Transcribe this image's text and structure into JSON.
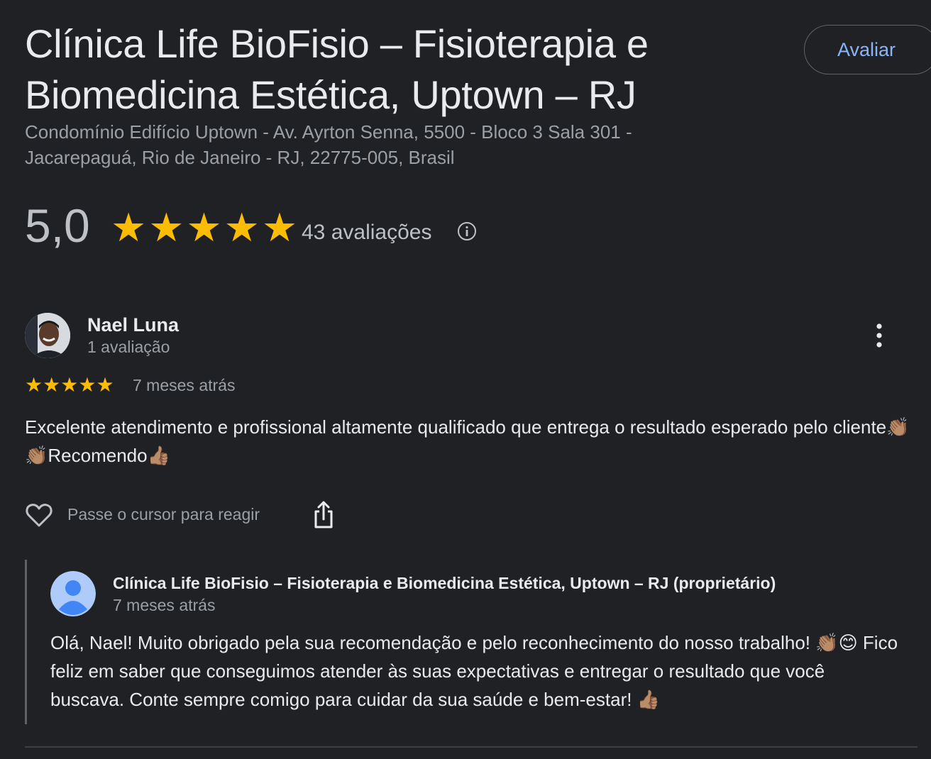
{
  "business": {
    "title": "Clínica Life BioFisio – Fisioterapia e Biomedicina Estética, Uptown – RJ",
    "address": "Condomínio Edifício Uptown - Av. Ayrton Senna, 5500 - Bloco 3 Sala 301 - Jacarepaguá, Rio de Janeiro - RJ, 22775-005, Brasil",
    "rate_label": "Avaliar"
  },
  "summary": {
    "score": "5,0",
    "stars": 5,
    "review_count": "43 avaliações",
    "star_color": "#fbbc04"
  },
  "review": {
    "author": "Nael Luna",
    "author_sub": "1 avaliação",
    "stars": 5,
    "time": "7 meses atrás",
    "text": "Excelente atendimento e profissional altamente qualificado que entrega o resultado esperado pelo cliente👏🏽👏🏽Recomendo👍🏽",
    "react_label": "Passe o cursor para reagir"
  },
  "reply": {
    "author": "Clínica Life BioFisio – Fisioterapia e Biomedicina Estética, Uptown – RJ (proprietário)",
    "time": "7 meses atrás",
    "text": "Olá, Nael! Muito obrigado pela sua recomendação e pelo reconhecimento do nosso trabalho! 👏🏽😊 Fico feliz em saber que conseguimos atender às suas expectativas e entregar o resultado que você buscava. Conte sempre comigo para cuidar da sua saúde e bem-estar! 👍🏽"
  },
  "colors": {
    "background": "#202124",
    "accent": "#8ab4f8",
    "avatar_blue": "#8ab4f8"
  }
}
